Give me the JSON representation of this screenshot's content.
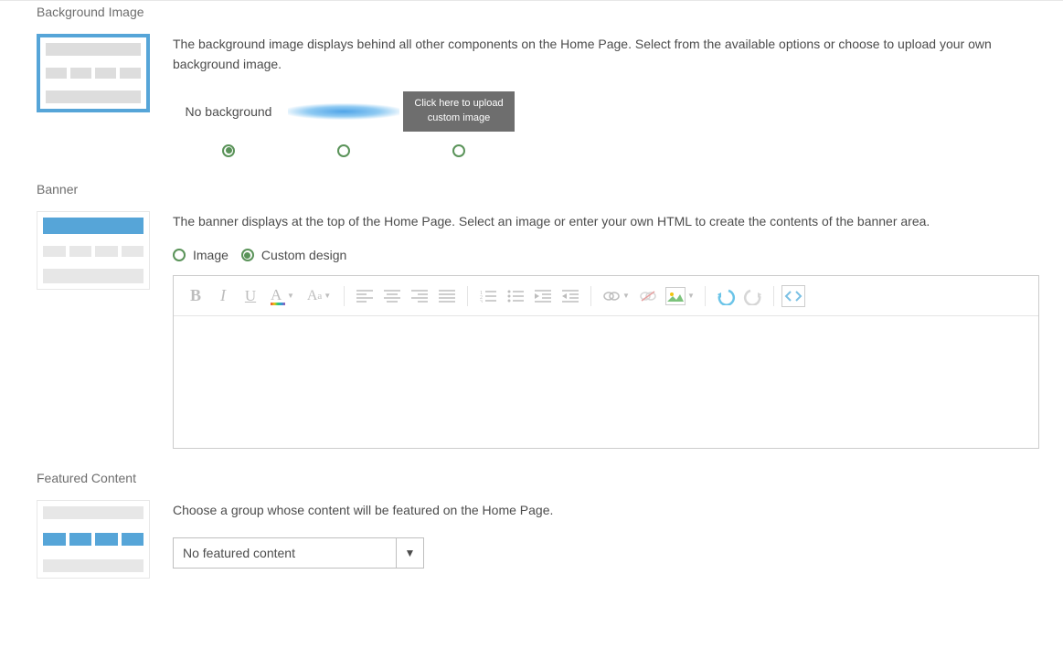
{
  "background_image": {
    "title": "Background Image",
    "description": "The background image displays behind all other components on the Home Page. Select from the available options or choose to upload your own background image.",
    "options": {
      "none": "No background",
      "upload": "Click here to upload custom image"
    }
  },
  "banner": {
    "title": "Banner",
    "description": "The banner displays at the top of the Home Page. Select an image or enter your own HTML to create the contents of the banner area.",
    "radio_image": "Image",
    "radio_custom": "Custom design"
  },
  "featured": {
    "title": "Featured Content",
    "description": "Choose a group whose content will be featured on the Home Page.",
    "select_value": "No featured content"
  }
}
